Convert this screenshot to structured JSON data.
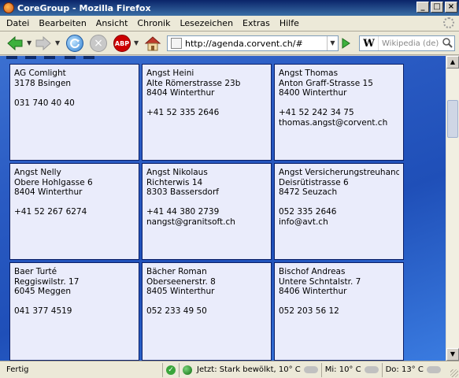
{
  "window": {
    "title": "CoreGroup - Mozilla Firefox"
  },
  "menu": [
    "Datei",
    "Bearbeiten",
    "Ansicht",
    "Chronik",
    "Lesezeichen",
    "Extras",
    "Hilfe"
  ],
  "toolbar": {
    "url": "http://agenda.corvent.ch/#",
    "search_placeholder": "Wikipedia (de)",
    "search_engine_glyph": "W",
    "abp_label": "ABP"
  },
  "cards": [
    {
      "lines": [
        "AG Comlight",
        "3178 Bsingen",
        "",
        "031 740 40 40"
      ]
    },
    {
      "lines": [
        "Angst Heini",
        "Alte Römerstrasse 23b",
        "8404 Winterthur",
        "",
        "+41 52 335 2646"
      ]
    },
    {
      "lines": [
        "Angst Thomas",
        "Anton Graff-Strasse 15",
        "8400 Winterthur",
        "",
        "+41 52 242 34 75",
        "thomas.angst@corvent.ch"
      ]
    },
    {
      "lines": [
        "Angst Nelly",
        "Obere Hohlgasse 6",
        "8404 Winterthur",
        "",
        "+41 52 267 6274"
      ]
    },
    {
      "lines": [
        "Angst Nikolaus",
        "Richterwis 14",
        "8303 Bassersdorf",
        "",
        "+41 44 380 2739",
        "nangst@granitsoft.ch"
      ]
    },
    {
      "lines": [
        "Angst Versicherungstreuhand",
        "Deisrütistrasse 6",
        "8472 Seuzach",
        "",
        "052 335 2646",
        "info@avt.ch"
      ]
    },
    {
      "lines": [
        "Baer Turté",
        "Reggiswilstr. 17",
        "6045 Meggen",
        "",
        "041 377 4519"
      ]
    },
    {
      "lines": [
        "Bächer Roman",
        "Oberseenerstr. 8",
        "8405 Winterthur",
        "",
        "052 233 49 50"
      ]
    },
    {
      "lines": [
        "Bischof Andreas",
        "Untere Schntalstr. 7",
        "8406 Winterthur",
        "",
        "052 203 56 12"
      ]
    }
  ],
  "status": {
    "text": "Fertig",
    "weather_now": "Jetzt: Stark bewölkt, 10° C",
    "weather_wed": "Mi: 10° C",
    "weather_thu": "Do: 13° C"
  }
}
